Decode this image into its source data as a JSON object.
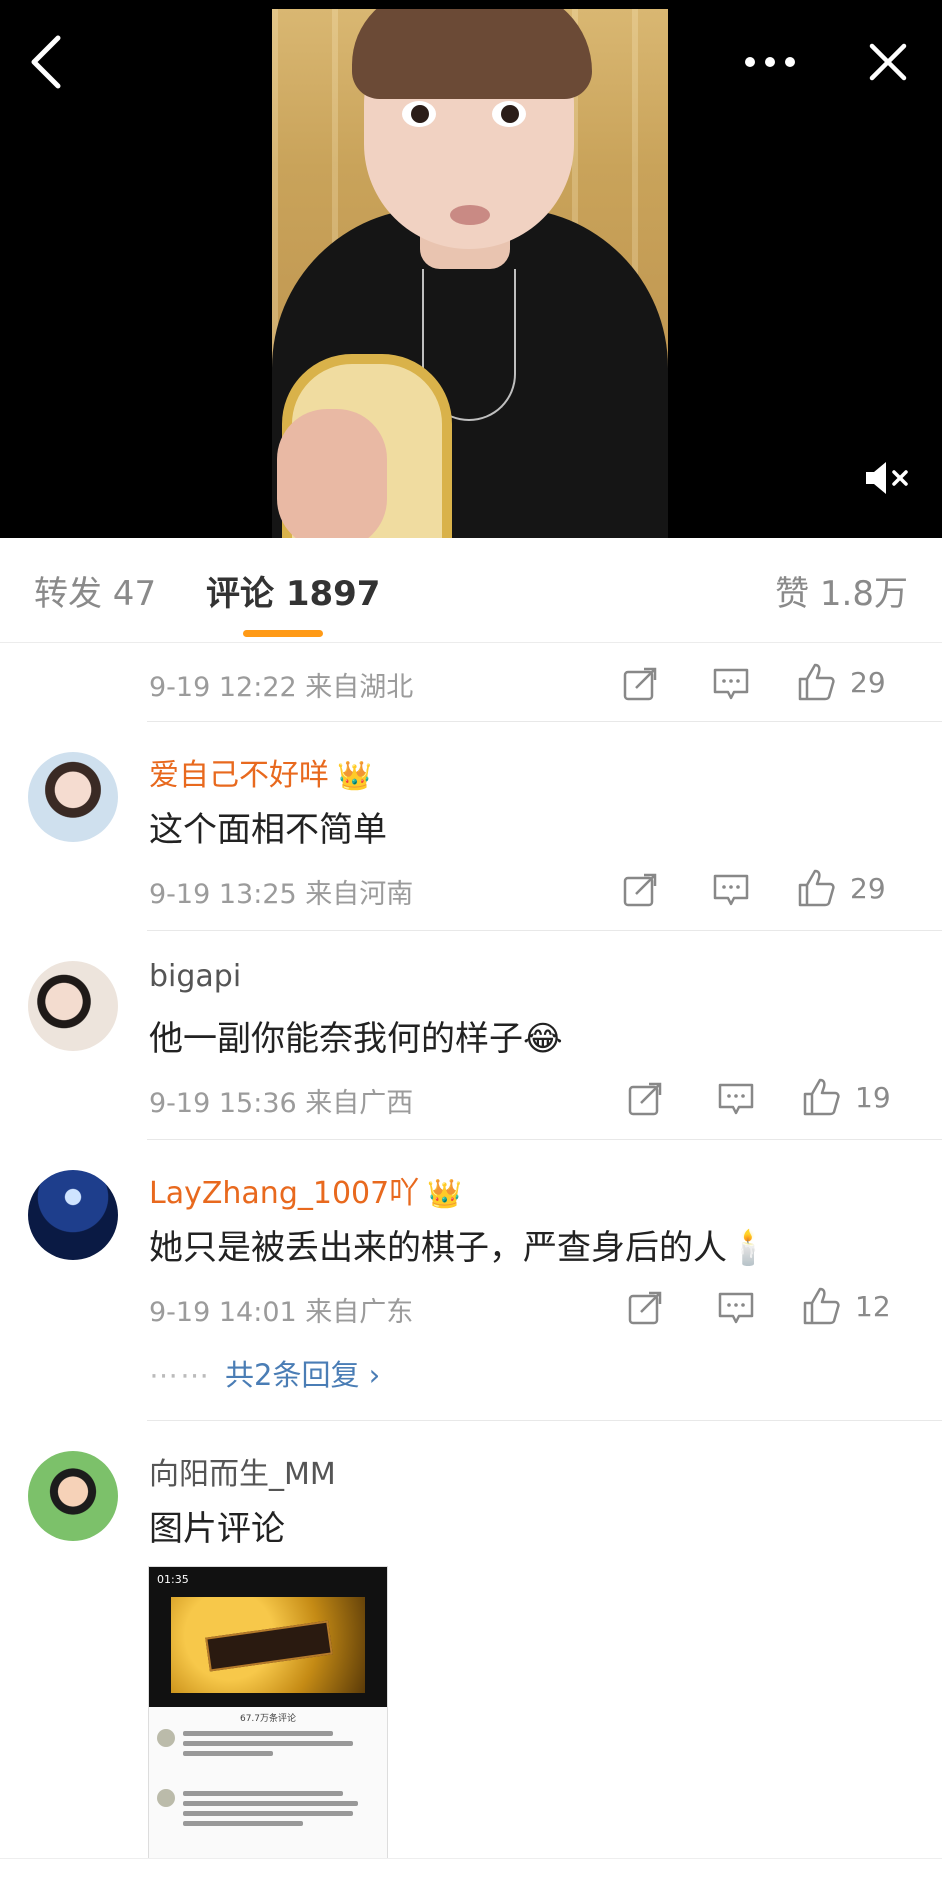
{
  "tabs": {
    "repost": "转发 47",
    "comment": "评论 1897",
    "like": "赞 1.8万"
  },
  "comments": [
    {
      "username": "",
      "text": "",
      "meta": "9-19 12:22 来自湖北",
      "likes": "29"
    },
    {
      "username": "爱自己不好咩",
      "text": "这个面相不简单",
      "meta": "9-19 13:25 来自河南",
      "likes": "29"
    },
    {
      "username": "bigapi",
      "text": "他一副你能奈我何的样子😂",
      "meta": "9-19 15:36 来自广西",
      "likes": "19"
    },
    {
      "username": "LayZhang_1007吖",
      "text": "她只是被丢出来的棋子，严查身后的人🕯️",
      "meta": "9-19 14:01 来自广东",
      "likes": "12",
      "more_replies": "共2条回复 ›",
      "more_dots": "⋯⋯"
    },
    {
      "username": "向阳而生_MM",
      "text": "图片评论",
      "image": {
        "status_time": "01:35",
        "panel_title": "67.7万条评论"
      }
    }
  ],
  "icons": {
    "back": "back-icon",
    "more": "more-icon",
    "close": "close-icon",
    "mute": "mute-icon",
    "share": "share-icon",
    "reply": "reply-icon",
    "like": "thumbs-up-icon",
    "crown": "crown-icon"
  },
  "colors": {
    "accent": "#ff9a16",
    "vip_name": "#e8691e",
    "link": "#4a7db5"
  }
}
